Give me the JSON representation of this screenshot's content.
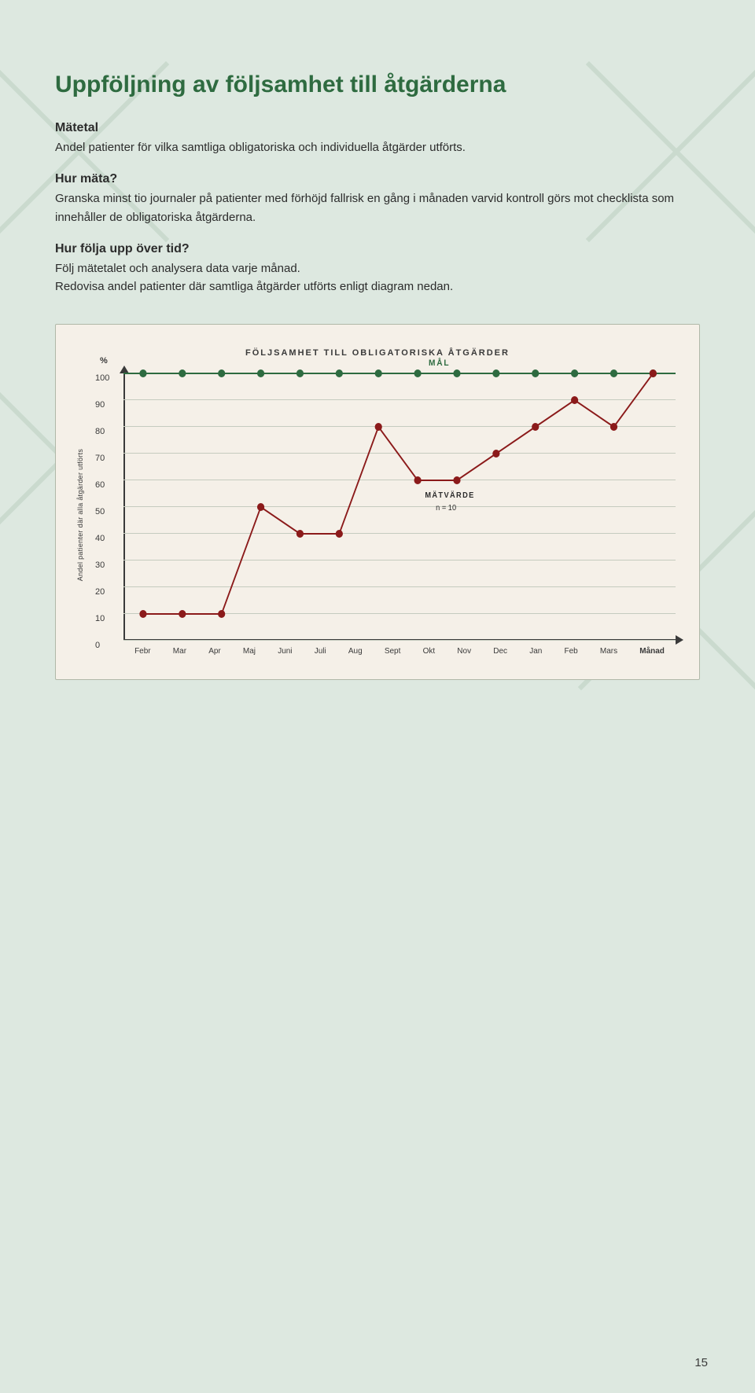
{
  "page": {
    "background_color": "#dde8e0",
    "page_number": "15"
  },
  "heading": {
    "title": "Uppföljning av följsamhet till åtgärderna"
  },
  "sections": {
    "mätetal": {
      "title": "Mätetal",
      "text": "Andel patienter för vilka samtliga obligatoriska och individuella åtgärder utförts."
    },
    "hur_mata": {
      "title": "Hur mäta?",
      "text": "Granska minst tio journaler på patienter med förhöjd fallrisk en gång i månaden varvid kontroll görs mot checklista som innehåller de obligatoriska åtgärderna."
    },
    "hur_folja": {
      "title": "Hur följa upp över tid?",
      "text1": "Följ mätetalet och analysera data varje månad.",
      "text2": "Redovisa andel patienter där samtliga åtgärder utförts enligt diagram nedan."
    }
  },
  "chart": {
    "title": "FÖLJSAMHET TILL OBLIGATORISKA ÅTGÄRDER",
    "y_axis_label": "Andel patienter där alla åtgärder utförts",
    "pct_label": "%",
    "y_ticks": [
      "100",
      "90",
      "80",
      "70",
      "60",
      "50",
      "40",
      "30",
      "20",
      "10",
      "0"
    ],
    "x_labels": [
      "Febr",
      "Mar",
      "Apr",
      "Maj",
      "Juni",
      "Juli",
      "Aug",
      "Sept",
      "Okt",
      "Nov",
      "Dec",
      "Jan",
      "Feb",
      "Mars",
      "Månad"
    ],
    "maal_label": "MÅL",
    "matvarde_label": "MÄTVÄRDE",
    "n_label": "n = 10",
    "goal_line_value": 100,
    "goal_color": "#2e6b40",
    "actual_color": "#8b0000",
    "data_points": {
      "months": [
        "Febr",
        "Mar",
        "Apr",
        "Maj",
        "Juni",
        "Juli",
        "Aug",
        "Sept",
        "Okt",
        "Nov",
        "Dec",
        "Jan",
        "Feb",
        "Mars"
      ],
      "values": [
        10,
        10,
        10,
        50,
        40,
        40,
        80,
        60,
        60,
        70,
        80,
        90,
        80,
        100
      ]
    }
  }
}
